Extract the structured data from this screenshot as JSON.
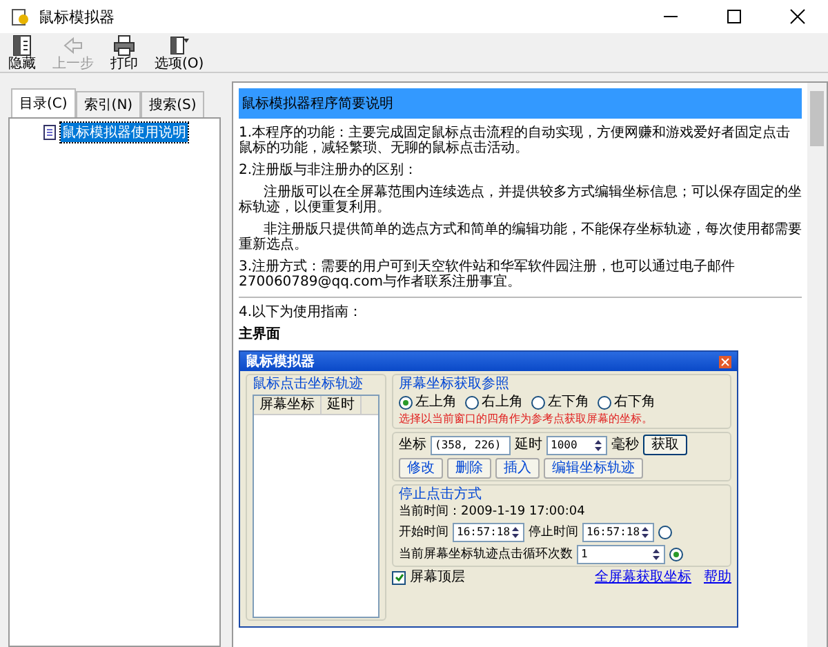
{
  "window": {
    "title": "鼠标模拟器"
  },
  "toolbar": [
    {
      "label": "隐藏",
      "kind": "hide",
      "disabled": false
    },
    {
      "label": "上一步",
      "kind": "back",
      "disabled": true
    },
    {
      "label": "打印",
      "kind": "print",
      "disabled": false
    },
    {
      "label": "选项(O)",
      "kind": "options",
      "disabled": false
    }
  ],
  "nav_tabs": [
    {
      "label": "目录(C)",
      "selected": true
    },
    {
      "label": "索引(N)",
      "selected": false
    },
    {
      "label": "搜索(S)",
      "selected": false
    }
  ],
  "tree": [
    {
      "label": "鼠标模拟器使用说明",
      "selected": true
    }
  ],
  "content": {
    "heading": "鼠标模拟器程序简要说明",
    "paragraphs": [
      {
        "kind": "para",
        "text": "1.本程序的功能：主要完成固定鼠标点击流程的自动实现，方便网赚和游戏爱好者固定点击鼠标的功能，减轻繁琐、无聊的鼠标点击活动。"
      },
      {
        "kind": "para",
        "text": "2.注册版与非注册办的区别："
      },
      {
        "kind": "sub",
        "text": "注册版可以在全屏幕范围内连续选点，并提供较多方式编辑坐标信息；可以保存固定的坐标轨迹，以便重复利用。"
      },
      {
        "kind": "sub",
        "text": "非注册版只提供简单的选点方式和简单的编辑功能，不能保存坐标轨迹，每次使用都需要重新选点。"
      },
      {
        "kind": "para",
        "text": "3.注册方式：需要的用户可到天空软件站和华军软件园注册，也可以通过电子邮件270060789@qq.com与作者联系注册事宜。"
      },
      {
        "kind": "rule"
      },
      {
        "kind": "para",
        "text": "4.以下为使用指南："
      },
      {
        "kind": "title",
        "text": "主界面"
      }
    ],
    "app": {
      "title": "鼠标模拟器",
      "track_group": {
        "title": "鼠标点击坐标轨迹",
        "columns": [
          "屏幕坐标",
          "延时"
        ]
      },
      "ref_group": {
        "title": "屏幕坐标获取参照",
        "options": [
          {
            "label": "左上角",
            "selected": true
          },
          {
            "label": "右上角",
            "selected": false
          },
          {
            "label": "左下角",
            "selected": false
          },
          {
            "label": "右下角",
            "selected": false
          }
        ],
        "hint": "选择以当前窗口的四角作为参考点获取屏幕的坐标。"
      },
      "coord": {
        "label": "坐标",
        "value": "(358, 226)",
        "delay_label": "延时",
        "delay_value": "1000",
        "unit": "毫秒",
        "get_button": "获取"
      },
      "buttons": [
        "修改",
        "删除",
        "插入",
        "编辑坐标轨迹"
      ],
      "stop_group": {
        "title": "停止点击方式",
        "current_time": "当前时间：2009-1-19 17:00:04",
        "time_mode": {
          "start_label": "开始时间",
          "start_value": "16:57:18",
          "stop_label": "停止时间",
          "stop_value": "16:57:18",
          "selected": false
        },
        "loop_mode": {
          "label": "当前屏幕坐标轨迹点击循环次数",
          "value": "1",
          "selected": true
        }
      },
      "topmost": {
        "label": "屏幕顶层",
        "checked": true
      },
      "links": [
        "全屏幕获取坐标",
        "帮助"
      ]
    }
  }
}
